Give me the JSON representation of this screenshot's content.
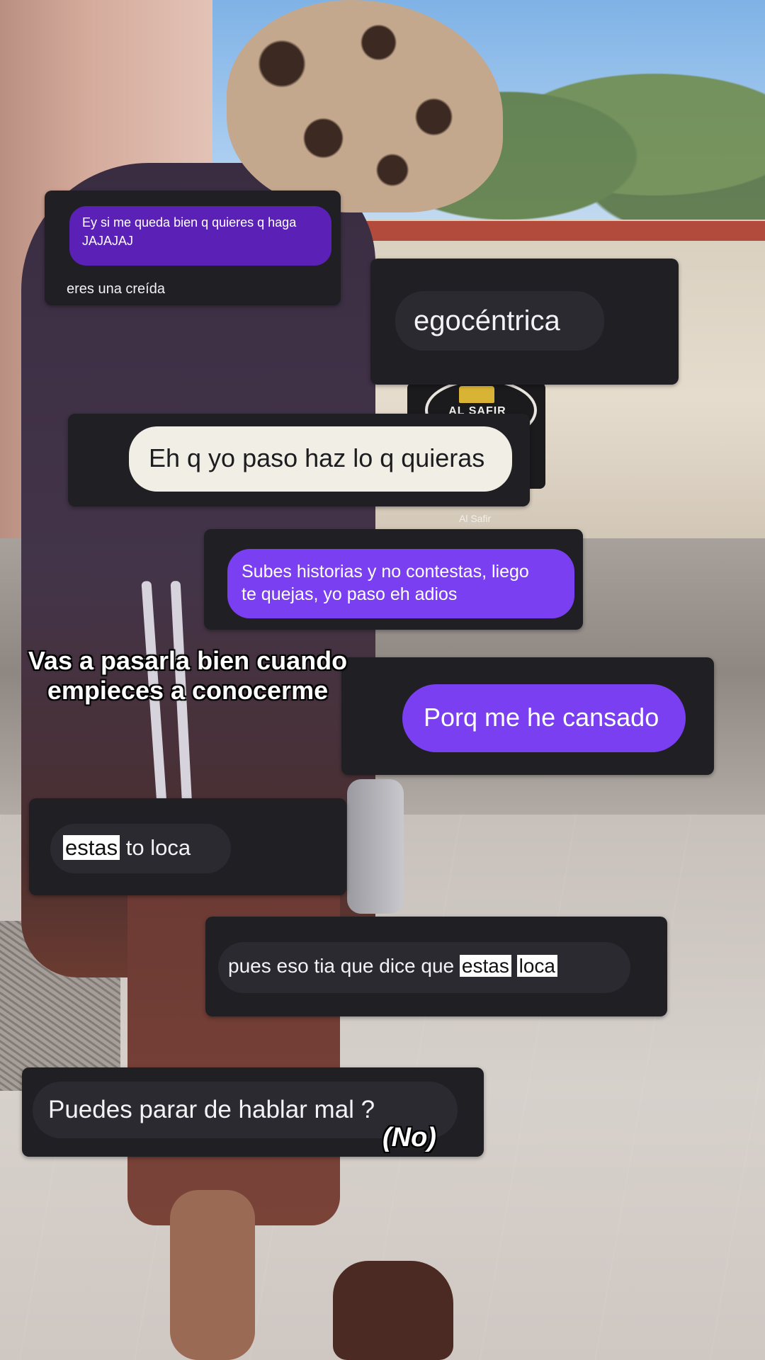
{
  "background": {
    "logo_text": "AL SAFIR",
    "logo_caption": "Al Safir"
  },
  "messages": [
    {
      "id": "m1",
      "text": "Ey si me queda bien q quieres q haga\nJAJAJAJ",
      "style": "purple"
    },
    {
      "id": "m2",
      "text": "eres una creída",
      "style": "dark"
    },
    {
      "id": "m3",
      "text": "egocéntrica",
      "style": "dark"
    },
    {
      "id": "m4",
      "text": "Eh q yo paso haz lo q quieras",
      "style": "light"
    },
    {
      "id": "m5",
      "text": "Subes historias y no contestas, liego\nte quejas, yo paso eh adios",
      "style": "purple"
    },
    {
      "id": "m6",
      "text": "Porq me he cansado",
      "style": "purple"
    },
    {
      "id": "m7",
      "parts": [
        "estas",
        " to loca"
      ],
      "style": "dark"
    },
    {
      "id": "m8",
      "parts": [
        "pues eso tia que dice que ",
        "estas",
        " ",
        "loca"
      ],
      "style": "dark"
    },
    {
      "id": "m9",
      "text": "Puedes parar de hablar mal ?",
      "style": "dark"
    }
  ],
  "overlay": {
    "caption": "Vas a pasarla bien cuando\nempieces a conocerme",
    "no_text": "(No)"
  },
  "colors": {
    "card_bg": "#202024",
    "purple_bubble": "#7a3ff0",
    "purple_bubble_dark": "#5b21b6",
    "light_bubble": "#f1eee6",
    "dark_bubble": "#2a2a30"
  }
}
